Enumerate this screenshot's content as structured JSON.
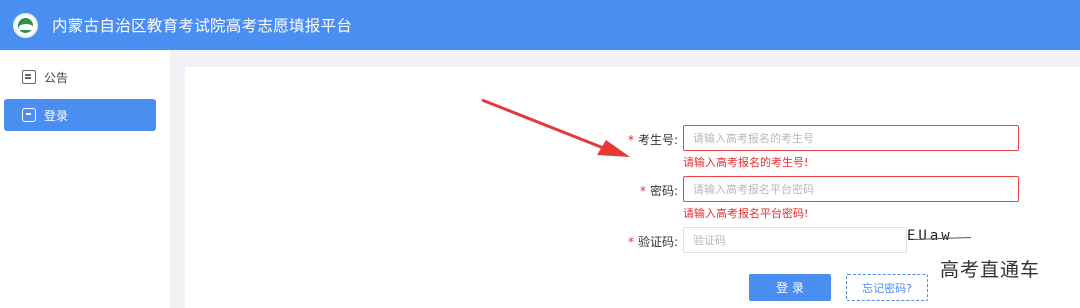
{
  "header": {
    "title": "内蒙古自治区教育考试院高考志愿填报平台",
    "logo_icon": "emblem-icon",
    "bg_color": "#4a8ef2"
  },
  "sidebar": {
    "items": [
      {
        "label": "公告",
        "icon": "notice-icon",
        "active": false
      },
      {
        "label": "登录",
        "icon": "login-icon",
        "active": true
      }
    ]
  },
  "form": {
    "exam_number": {
      "label": "考生号:",
      "placeholder": "请输入高考报名的考生号",
      "value": "",
      "error": "请输入高考报名的考生号!"
    },
    "password": {
      "label": "密码:",
      "placeholder": "请输入高考报名平台密码",
      "value": "",
      "error": "请输入高考报名平台密码!"
    },
    "captcha": {
      "label": "验证码:",
      "placeholder": "验证码",
      "value": "",
      "image_text": "EUaw"
    },
    "required_mark": "*",
    "login_button": "登 录",
    "forgot_button": "忘记密码?"
  },
  "annotation": {
    "arrow_color": "#e53935"
  },
  "watermark": "高考直通车"
}
